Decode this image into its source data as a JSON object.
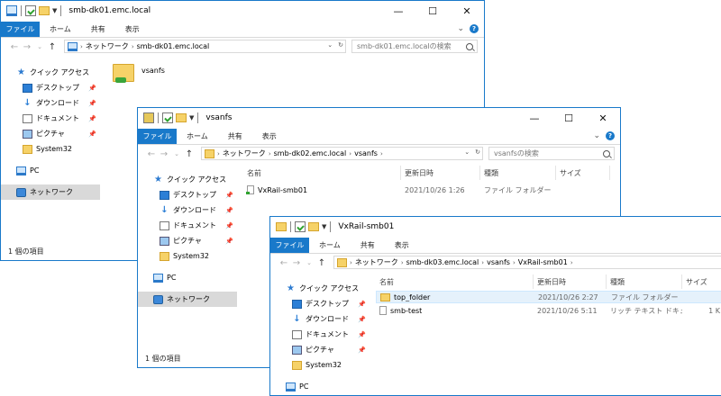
{
  "ribbon": {
    "file": "ファイル",
    "home": "ホーム",
    "share": "共有",
    "view": "表示"
  },
  "sidebar_labels": {
    "quick_access": "クイック アクセス",
    "desktop": "デスクトップ",
    "downloads": "ダウンロード",
    "documents": "ドキュメント",
    "pictures": "ピクチャ",
    "system32": "System32",
    "pc": "PC",
    "network": "ネットワーク"
  },
  "columns": {
    "name": "名前",
    "modified": "更新日時",
    "type": "種類",
    "size": "サイズ"
  },
  "windows": {
    "w1": {
      "title": "smb-dk01.emc.local",
      "breadcrumb": [
        "ネットワーク",
        "smb-dk01.emc.local"
      ],
      "search_placeholder": "smb-dk01.emc.localの検索",
      "items": [
        {
          "name": "vsanfs",
          "icon": "network-share-folder-icon"
        }
      ],
      "status": "1 個の項目"
    },
    "w2": {
      "title": "vsanfs",
      "breadcrumb": [
        "ネットワーク",
        "smb-dk02.emc.local",
        "vsanfs"
      ],
      "search_placeholder": "vsanfsの検索",
      "rows": [
        {
          "name": "VxRail-smb01",
          "modified": "2021/10/26 1:26",
          "type": "ファイル フォルダー",
          "size": ""
        }
      ],
      "status": "1 個の項目"
    },
    "w3": {
      "title": "VxRail-smb01",
      "breadcrumb": [
        "ネットワーク",
        "smb-dk03.emc.local",
        "vsanfs",
        "VxRail-smb01"
      ],
      "rows": [
        {
          "name": "top_folder",
          "modified": "2021/10/26 2:27",
          "type": "ファイル フォルダー",
          "size": ""
        },
        {
          "name": "smb-test",
          "modified": "2021/10/26 5:11",
          "type": "リッチ テキスト ドキュ...",
          "size": "1 K"
        }
      ],
      "partial_sidebar": "PC"
    }
  },
  "colors": {
    "accent": "#1979ca",
    "folder": "#f6d268",
    "selection": "#d9d9d9",
    "row_highlight": "#e5f1fb"
  }
}
